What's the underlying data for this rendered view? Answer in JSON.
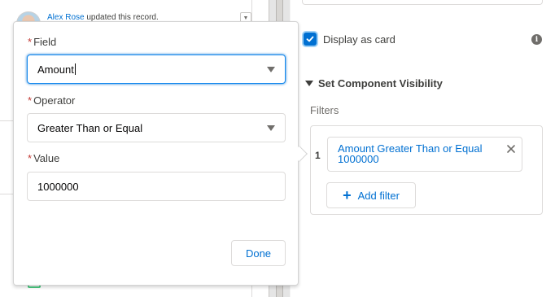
{
  "feed": {
    "author": "Alex Rose",
    "action": " updated this record."
  },
  "properties": {
    "display_as_card_label": "Display as card",
    "display_as_card_checked": true,
    "section_title": "Set Component Visibility",
    "filters_label": "Filters",
    "filters": [
      {
        "index": "1",
        "line1": "Amount Greater Than or Equal",
        "line2": "1000000"
      }
    ],
    "add_filter_label": "Add filter"
  },
  "popover": {
    "field_label": "Field",
    "field_value": "Amount",
    "operator_label": "Operator",
    "operator_value": "Greater Than or Equal",
    "value_label": "Value",
    "value_value": "1000000",
    "required_marker": "*",
    "done_label": "Done"
  },
  "colors": {
    "brand": "#0070d2",
    "required": "#c23934",
    "border": "#dddbda"
  }
}
